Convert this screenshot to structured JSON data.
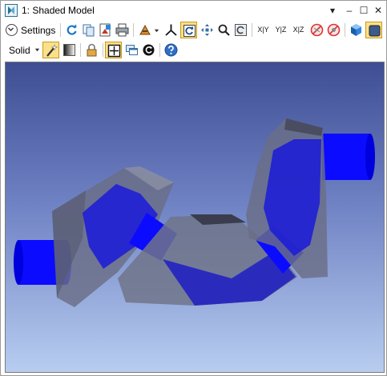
{
  "window": {
    "title": "1: Shaded Model"
  },
  "titlebar_buttons": {
    "dropdown": "▾",
    "minimize": "–",
    "maximize": "☐",
    "close": "✕"
  },
  "toolbar": {
    "settings_label": "Settings",
    "render_mode": "Solid",
    "axis_buttons": {
      "xy": "X|Y",
      "yz": "Y|Z",
      "xz": "X|Z"
    }
  },
  "colors": {
    "active_button": "#fbe08a",
    "viewport_top": "#3f4e93",
    "viewport_bottom": "#b8cdf0",
    "cylinder": "#0b0bff",
    "housing": "#6a6e86"
  },
  "icons": [
    "settings-chevron-icon",
    "refresh-icon",
    "copy-icon",
    "save-image-icon",
    "print-icon",
    "render-options-icon",
    "axes-triad-icon",
    "rotate-icon",
    "pan-icon",
    "zoom-icon",
    "zoom-fit-icon",
    "view-xy-icon",
    "view-yz-icon",
    "view-xz-icon",
    "no-fly-icon",
    "no-select-icon",
    "shaded-cube-icon",
    "background-icon",
    "wand-icon",
    "gradient-icon",
    "lock-icon",
    "fit-frame-icon",
    "windows-icon",
    "reset-icon",
    "help-icon"
  ]
}
